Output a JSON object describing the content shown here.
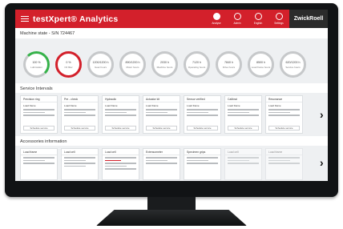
{
  "header": {
    "app_title": "testXpert® Analytics",
    "brand": "ZwickRoell",
    "actions": [
      {
        "icon": "dashboard-icon",
        "label": "Analyse"
      },
      {
        "icon": "user-icon",
        "label": "Admin"
      },
      {
        "icon": "globe-icon",
        "label": "English"
      },
      {
        "icon": "settings-icon",
        "label": "Settings"
      }
    ]
  },
  "machine": {
    "title": "Machine state - S/N 724467",
    "gauges": [
      {
        "value": "100 %",
        "label": "Lubrication"
      },
      {
        "value": "0 %",
        "label": "Oil filter"
      },
      {
        "value": "1200/1200 h",
        "label": "Gear hours"
      },
      {
        "value": "890/1200 h",
        "label": "Motor hours"
      },
      {
        "value": "2030 h",
        "label": "Machine hours"
      },
      {
        "value": "7120 h",
        "label": "Operating hours"
      },
      {
        "value": "7840 h",
        "label": "Drive hours"
      },
      {
        "value": "8500 h",
        "label": "Load frame hours"
      },
      {
        "value": "620/1200 h",
        "label": "Service hours"
      }
    ]
  },
  "service": {
    "title": "Service Intervals",
    "cards": [
      {
        "title": "Precision ring",
        "sub": "Load frame",
        "button": "Schedule service"
      },
      {
        "title": "Pre - check",
        "sub": "Load frame",
        "button": "Schedule service"
      },
      {
        "title": "Hydraulic",
        "sub": "Load frame",
        "button": "Schedule service"
      },
      {
        "title": "Actuator kit",
        "sub": "Load frame",
        "button": "Schedule service"
      },
      {
        "title": "Sensor verified",
        "sub": "Load frame",
        "button": "Schedule service"
      },
      {
        "title": "Calibrat",
        "sub": "Load frame",
        "button": "Schedule service"
      },
      {
        "title": "Resonance",
        "sub": "Load frame",
        "button": "Schedule service"
      }
    ]
  },
  "accessories": {
    "title": "Accessories information",
    "cards": [
      {
        "title": "Load frame"
      },
      {
        "title": "Load cell"
      },
      {
        "title": "Load cell"
      },
      {
        "title": "Extensometer"
      },
      {
        "title": "Specimen grips"
      },
      {
        "title": "Load cell"
      },
      {
        "title": "Load frame"
      }
    ]
  }
}
